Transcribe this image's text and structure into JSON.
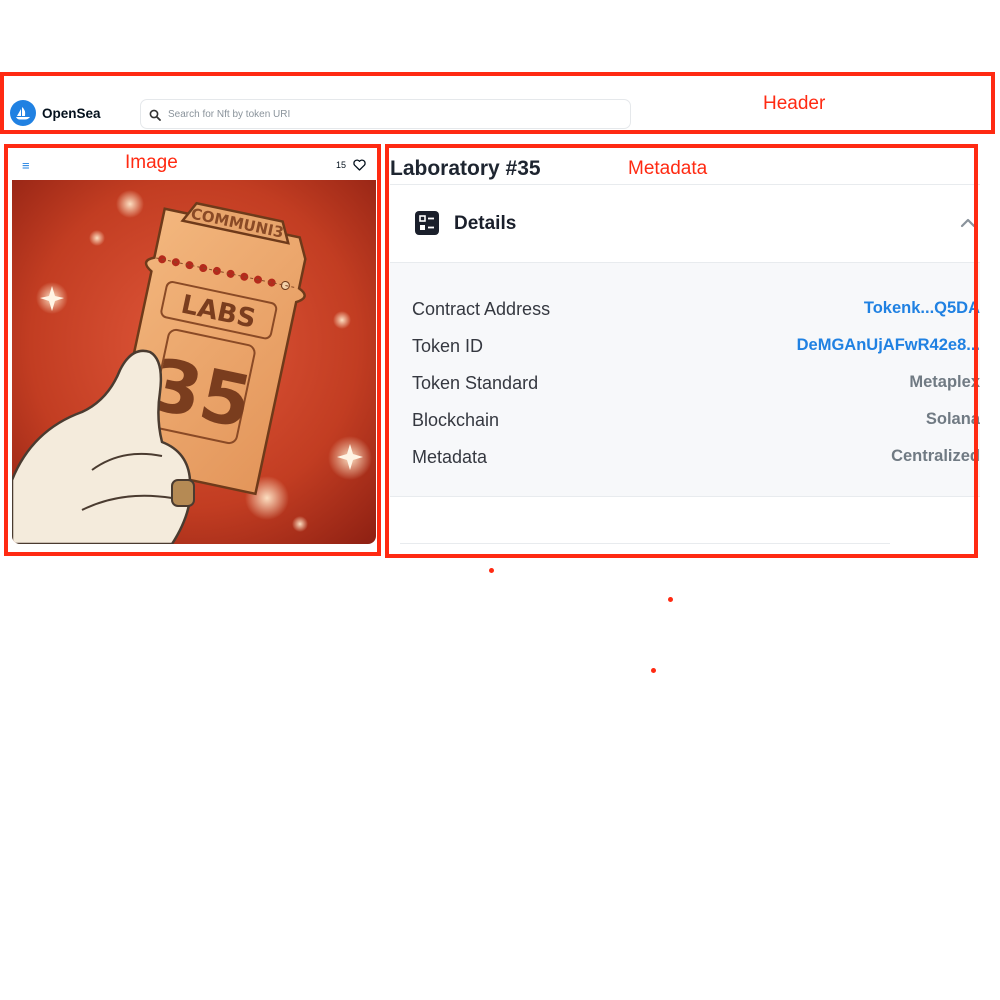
{
  "header": {
    "brand": "OpenSea",
    "search_placeholder": "Search for Nft by token URI"
  },
  "annotations": {
    "header": "Header",
    "image": "Image",
    "metadata": "Metadata"
  },
  "image_panel": {
    "like_count": "15",
    "artwork": {
      "top_text": "COMMUNI3",
      "middle_text": "LABS",
      "number": "35"
    }
  },
  "nft": {
    "title": "Laboratory #35",
    "details_title": "Details",
    "rows": [
      {
        "label": "Contract Address",
        "value": "Tokenk...Q5DA"
      },
      {
        "label": "Token ID",
        "value": "DeMGAnUjAFwR42e8..."
      },
      {
        "label": "Token Standard",
        "value": "Metaplex"
      },
      {
        "label": "Blockchain",
        "value": "Solana"
      },
      {
        "label": "Metadata",
        "value": "Centralized"
      }
    ]
  },
  "colors": {
    "accent": "#2081e2",
    "annotation": "#ff2a12",
    "artwork_bg": "#b6301b",
    "ticket": "#f0a868"
  },
  "icons": [
    "opensea-logo-icon",
    "search-icon",
    "menu-icon",
    "heart-icon",
    "details-list-icon",
    "chevron-up-icon"
  ]
}
